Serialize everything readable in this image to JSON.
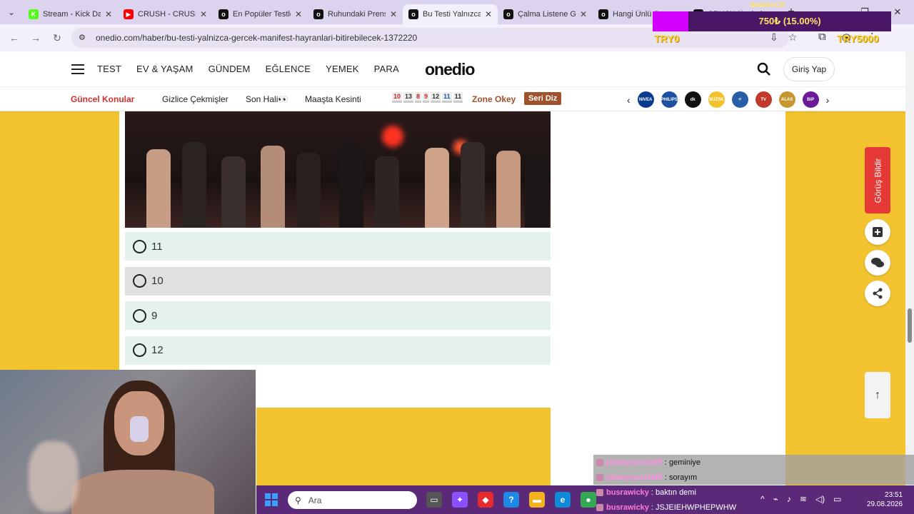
{
  "browser": {
    "tabs": [
      {
        "title": "Stream - Kick Da",
        "favicon_color": "#53fc18",
        "favicon_char": "K"
      },
      {
        "title": "CRUSH - CRUSH",
        "favicon_color": "#ff0000",
        "favicon_char": "▶"
      },
      {
        "title": "En Popüler Testle",
        "favicon_color": "#111111",
        "favicon_char": "o"
      },
      {
        "title": "Ruhundaki Prens",
        "favicon_color": "#111111",
        "favicon_char": "o"
      },
      {
        "title": "Bu Testi Yalnızca",
        "favicon_color": "#111111",
        "favicon_char": "o",
        "active": true
      },
      {
        "title": "Çalma Listene G",
        "favicon_color": "#111111",
        "favicon_char": "o"
      },
      {
        "title": "Hangi Ünlü Se",
        "favicon_color": "#111111",
        "favicon_char": "o"
      },
      {
        "title": "CRUSH Üyeleri",
        "favicon_color": "#111111",
        "favicon_char": "o"
      }
    ],
    "url": "onedio.com/haber/bu-testi-yalnizca-gercek-manifest-hayranlari-bitirebilecek-1372220"
  },
  "overlay": {
    "donation_top": "dedalinCR",
    "donation_text": "750₺ (15.00%)",
    "donation_progress": 0.15,
    "try_left": "TRY0",
    "try_right": "TRY5000"
  },
  "site": {
    "logo": "onedio",
    "nav": [
      "TEST",
      "EV & YAŞAM",
      "GÜNDEM",
      "EĞLENCE",
      "YEMEK",
      "PARA"
    ],
    "login_label": "Giriş Yap",
    "guncel_label": "Güncel Konular",
    "topics": [
      "Gizlice Çekmişler",
      "Son Hali👀",
      "Maaşta Kesinti"
    ],
    "number_tag": [
      "10",
      "13",
      "8",
      "9",
      "12",
      "11",
      "11"
    ],
    "zone_label": "Zone Okey",
    "seri_label": "Seri Diz",
    "brands": [
      {
        "name": "NIVEA",
        "color": "#0a3b8c"
      },
      {
        "name": "PHILIPS",
        "color": "#1e50a2"
      },
      {
        "name": "dk",
        "color": "#111111"
      },
      {
        "name": "BÜZSK",
        "color": "#f2c12e"
      },
      {
        "name": "✳",
        "color": "#2a5ea8"
      },
      {
        "name": "TV",
        "color": "#c0392b"
      },
      {
        "name": "ALAS",
        "color": "#c8962e"
      },
      {
        "name": "BiP",
        "color": "#6a1b9a"
      }
    ],
    "feedback_label": "Görüş Bildir"
  },
  "quiz": {
    "options": [
      "11",
      "10",
      "9",
      "12"
    ]
  },
  "taskbar": {
    "search_placeholder": "Ara",
    "time": "23:51",
    "date": "29.08.2026"
  },
  "chat": [
    {
      "user": "pilawyiyenilafff",
      "user_color": "#ff8fe0",
      "message": "geminiye",
      "dim": true
    },
    {
      "user": "pilawyiyenilafff",
      "user_color": "#ff8fe0",
      "message": "sorayım",
      "dim": true
    },
    {
      "user": "busrawicky",
      "user_color": "#ff7ad9",
      "message": "baktın demi",
      "dim": false
    },
    {
      "user": "busrawicky",
      "user_color": "#ff7ad9",
      "message": "JSJEIEHWPHEPWHW",
      "dim": false
    }
  ]
}
